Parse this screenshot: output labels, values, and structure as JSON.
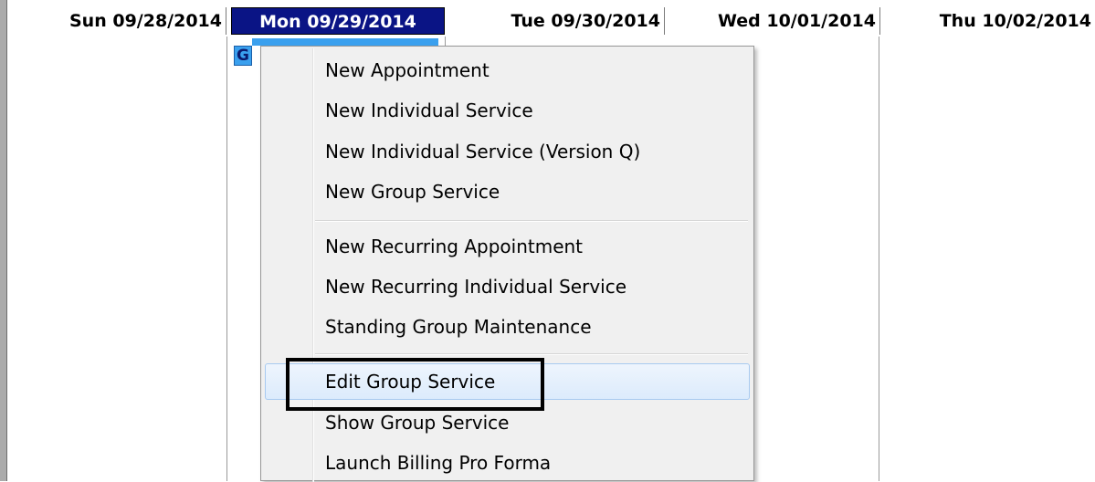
{
  "calendar": {
    "days": [
      {
        "label": "Sun 09/28/2014",
        "selected": false
      },
      {
        "label": "Mon 09/29/2014",
        "selected": true
      },
      {
        "label": "Tue 09/30/2014",
        "selected": false
      },
      {
        "label": "Wed 10/01/2014",
        "selected": false
      },
      {
        "label": "Thu 10/02/2014",
        "selected": false
      }
    ],
    "group_badge": "G"
  },
  "context_menu": {
    "items": [
      "New Appointment",
      "New Individual Service",
      "New Individual Service (Version Q)",
      "New Group Service",
      "New Recurring Appointment",
      "New Recurring Individual Service",
      "Standing Group Maintenance",
      "Edit Group Service",
      "Show Group Service",
      "Launch Billing Pro Forma"
    ],
    "highlighted": "Edit Group Service"
  },
  "colors": {
    "selected_header_bg": "#0a1485",
    "badge_bg": "#3aa0ee",
    "menu_bg": "#f0f0f0",
    "highlight_border": "#a8caf0"
  },
  "icons": [
    "group-appointment-icon"
  ]
}
